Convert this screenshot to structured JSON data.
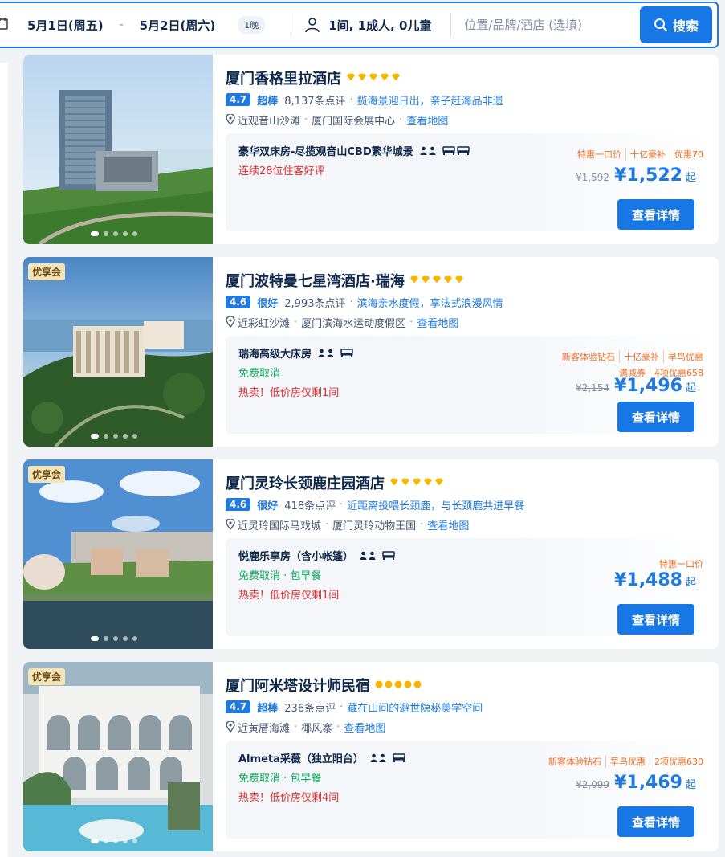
{
  "search": {
    "checkin": "5月1日(周五)",
    "checkout": "5月2日(周六)",
    "dash": "-",
    "nights": "1晚",
    "guests": "1间, 1成人, 0儿童",
    "placeholder": "位置/品牌/酒店 (选填)",
    "search_label": "搜索"
  },
  "hotels": [
    {
      "name": "厦门香格里拉酒店",
      "vip": "",
      "stars": 5,
      "star_style": "diamond",
      "score": "4.7",
      "level": "超棒",
      "reviews": "8,137条点评",
      "tagline": "揽海景迎日出，亲子赶海品非遗",
      "location1": "近观音山沙滩",
      "location2": "厦门国际会展中心",
      "map_link": "查看地图",
      "room": "豪华双床房-尽揽观音山CBD繁华城景",
      "line1": "连续28位住客好评",
      "line1_color": "red",
      "line2": "",
      "promos_row1": [
        "特惠一口价",
        "十亿豪补",
        "优惠70"
      ],
      "promos_row2": [],
      "old_price": "¥1,592",
      "price": "¥1,522",
      "qi": "起",
      "detail_label": "查看详情"
    },
    {
      "name": "厦门波特曼七星湾酒店·瑞海",
      "vip": "优享会",
      "stars": 5,
      "star_style": "diamond",
      "score": "4.6",
      "level": "很好",
      "reviews": "2,993条点评",
      "tagline": "滨海亲水度假，享法式浪漫风情",
      "location1": "近彩虹沙滩",
      "location2": "厦门滨海水运动度假区",
      "map_link": "查看地图",
      "room": "瑞海高级大床房",
      "line1": "免费取消",
      "line1_color": "green",
      "line2": "热卖！低价房仅剩1间",
      "promos_row1": [
        "新客体验钻石",
        "十亿豪补",
        "早鸟优惠"
      ],
      "promos_row2": [
        "满减券",
        "4项优惠658"
      ],
      "old_price": "¥2,154",
      "price": "¥1,496",
      "qi": "起",
      "detail_label": "查看详情"
    },
    {
      "name": "厦门灵玲长颈鹿庄园酒店",
      "vip": "优享会",
      "stars": 5,
      "star_style": "diamond",
      "score": "4.6",
      "level": "很好",
      "reviews": "418条点评",
      "tagline": "近距离投喂长颈鹿，与长颈鹿共进早餐",
      "location1": "近灵玲国际马戏城",
      "location2": "厦门灵玲动物王国",
      "map_link": "查看地图",
      "room": "悦鹿乐享房（含小帐篷）",
      "line1": "免费取消 · 包早餐",
      "line1_color": "green",
      "line2": "热卖！低价房仅剩1间",
      "promos_row1": [
        "特惠一口价"
      ],
      "promos_row2": [],
      "old_price": "",
      "price": "¥1,488",
      "qi": "起",
      "detail_label": "查看详情"
    },
    {
      "name": "厦门阿米塔设计师民宿",
      "vip": "优享会",
      "stars": 5,
      "star_style": "circle",
      "score": "4.7",
      "level": "超棒",
      "reviews": "236条点评",
      "tagline": "藏在山间的避世隐秘美学空间",
      "location1": "近黄厝海滩",
      "location2": "椰风寨",
      "map_link": "查看地图",
      "room": "Almeta采薇（独立阳台）",
      "line1": "免费取消 · 包早餐",
      "line1_color": "green",
      "line2": "热卖！低价房仅剩4间",
      "promos_row1": [
        "新客体验钻石",
        "早鸟优惠",
        "2项优惠630"
      ],
      "promos_row2": [],
      "old_price": "¥2,099",
      "price": "¥1,469",
      "qi": "起",
      "detail_label": "查看详情"
    }
  ]
}
